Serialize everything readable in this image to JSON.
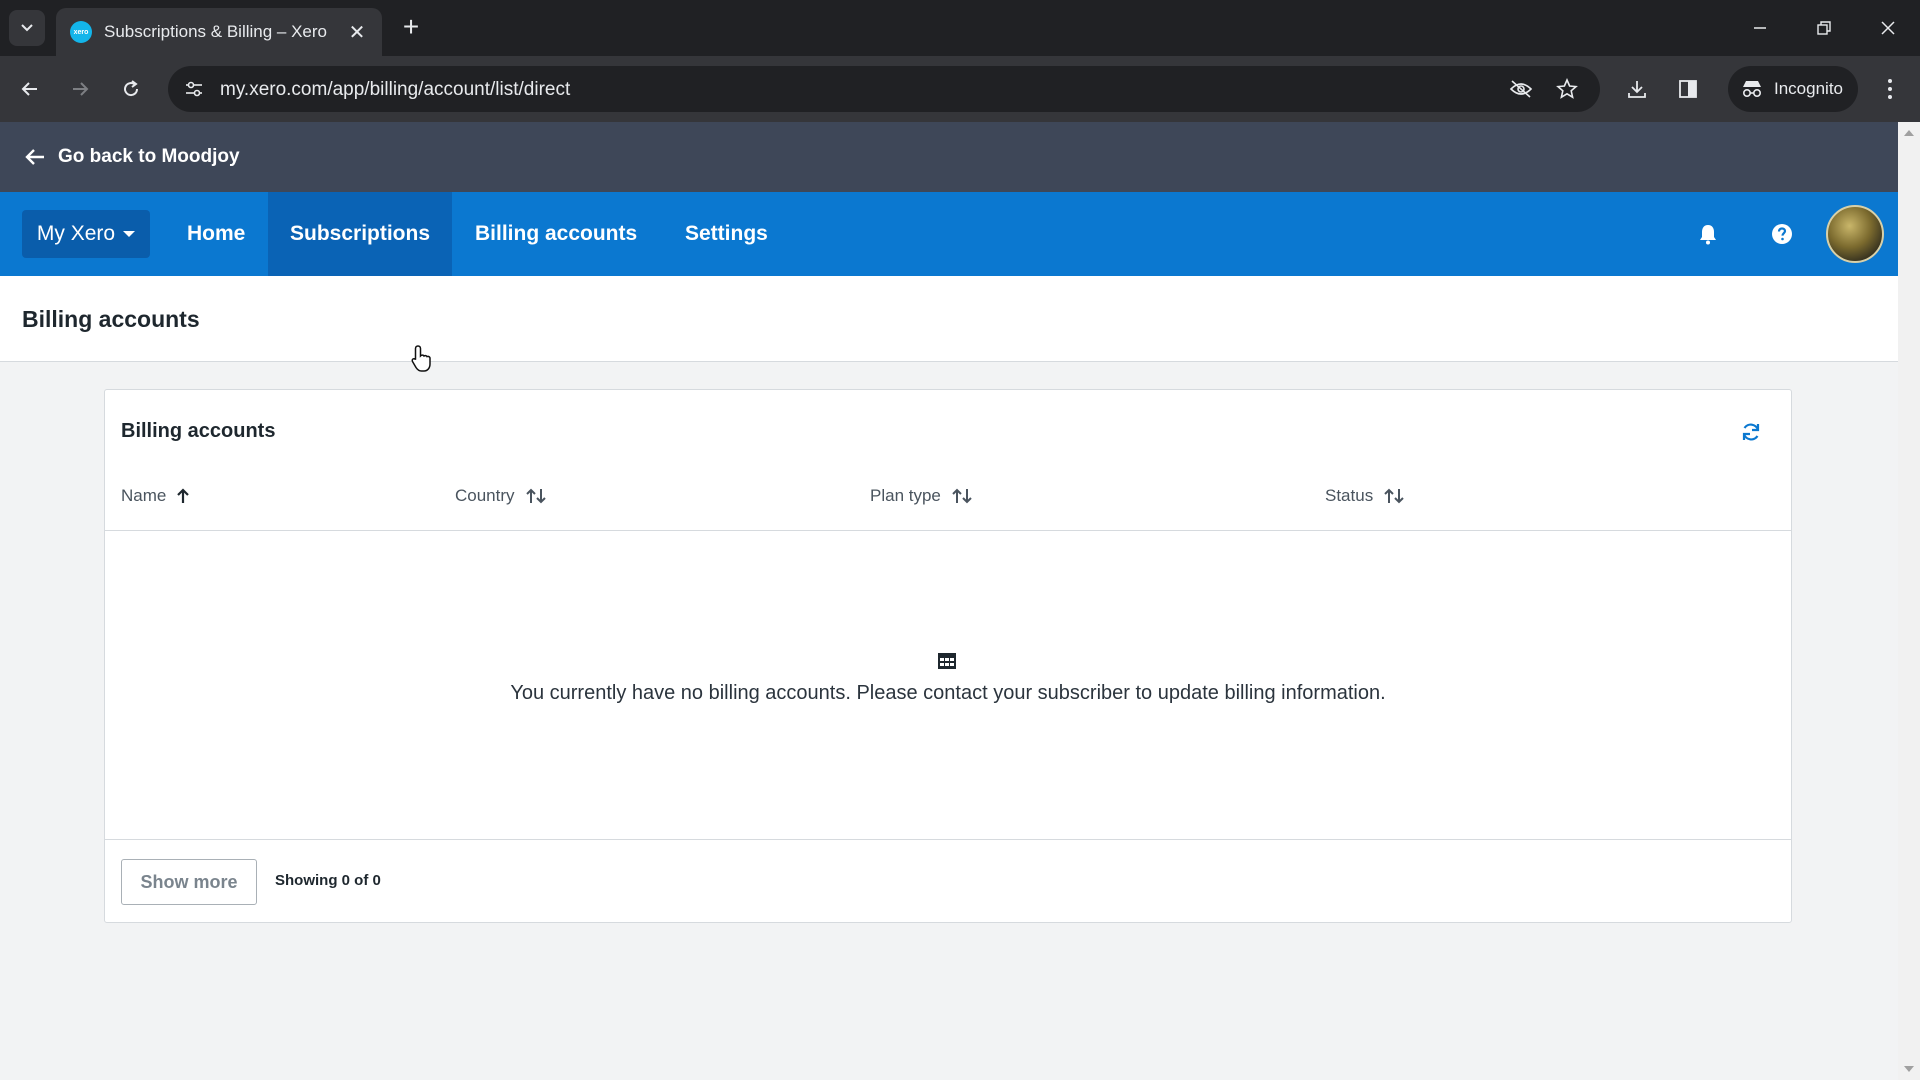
{
  "browser": {
    "tab_title": "Subscriptions & Billing – Xero",
    "favicon_label": "xero",
    "url": "my.xero.com/app/billing/account/list/direct",
    "incognito_label": "Incognito"
  },
  "app": {
    "back_link": "Go back to Moodjoy",
    "nav": {
      "my_xero": "My Xero",
      "home": "Home",
      "subscriptions": "Subscriptions",
      "billing_accounts": "Billing accounts",
      "settings": "Settings"
    },
    "page_title": "Billing accounts"
  },
  "card": {
    "title": "Billing accounts",
    "columns": [
      {
        "label": "Name",
        "sort": "ascending"
      },
      {
        "label": "Country",
        "sort": "none"
      },
      {
        "label": "Plan type",
        "sort": "none"
      },
      {
        "label": "Status",
        "sort": "none"
      }
    ],
    "empty_message": "You currently have no billing accounts. Please contact your subscriber to update billing information.",
    "show_more_label": "Show more",
    "showing_text": "Showing 0 of 0"
  },
  "colors": {
    "nav_blue": "#0b78d0",
    "nav_active": "#0a63b5",
    "back_bar": "#3e4758",
    "refresh_blue": "#0b78d0"
  }
}
